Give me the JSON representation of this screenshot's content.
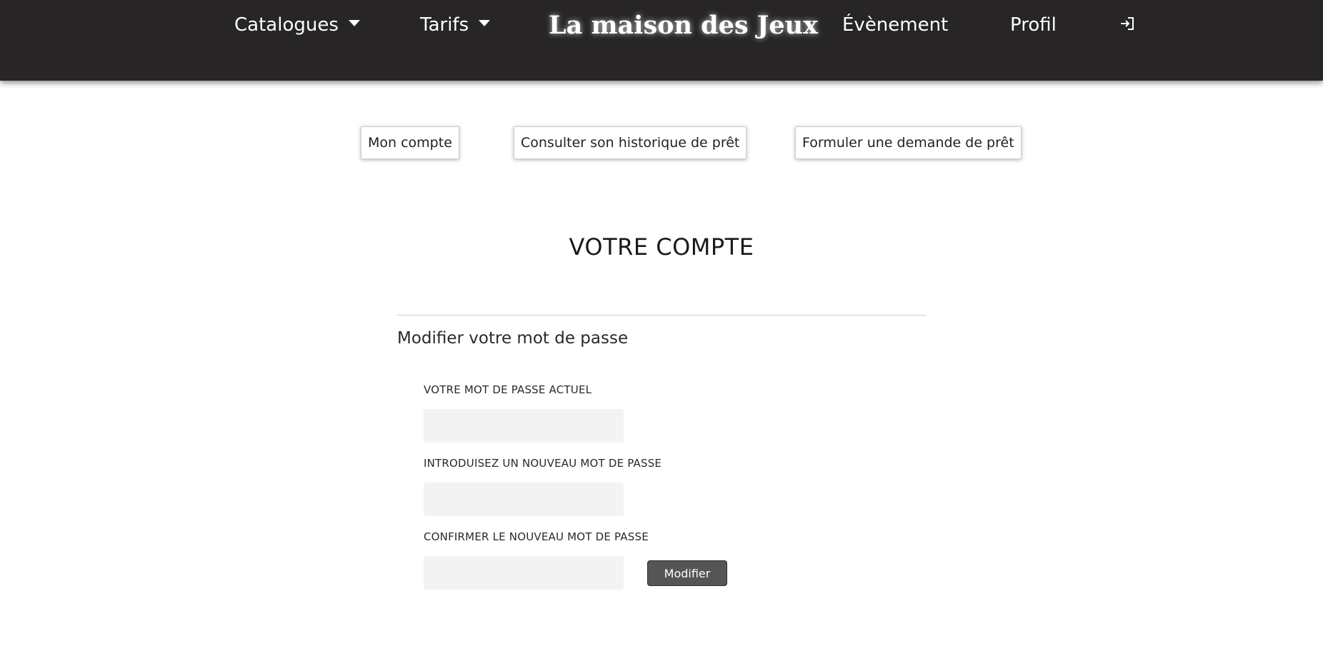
{
  "navbar": {
    "catalogues_label": "Catalogues",
    "tarifs_label": "Tarifs",
    "brand": "La maison des Jeux",
    "evenement_label": "Évènement",
    "profil_label": "Profil",
    "login_icon": "sign-in-icon",
    "background_color": "#272526"
  },
  "subnav": {
    "account_label": "Mon compte",
    "history_label": "Consulter son historique de prêt",
    "request_label": "Formuler une demande de prêt"
  },
  "main": {
    "title": "VOTRE COMPTE",
    "section_title": "Modifier votre mot de passe",
    "form": {
      "current_password_label": "VOTRE MOT DE PASSE ACTUEL",
      "current_password_value": "",
      "new_password_label": "INTRODUISEZ UN NOUVEAU MOT DE PASSE",
      "new_password_value": "",
      "confirm_password_label": "CONFIRMER LE NOUVEAU MOT DE PASSE",
      "confirm_password_value": "",
      "submit_label": "Modifier",
      "input_background": "#f3f3f3",
      "button_color": "#555555"
    }
  }
}
